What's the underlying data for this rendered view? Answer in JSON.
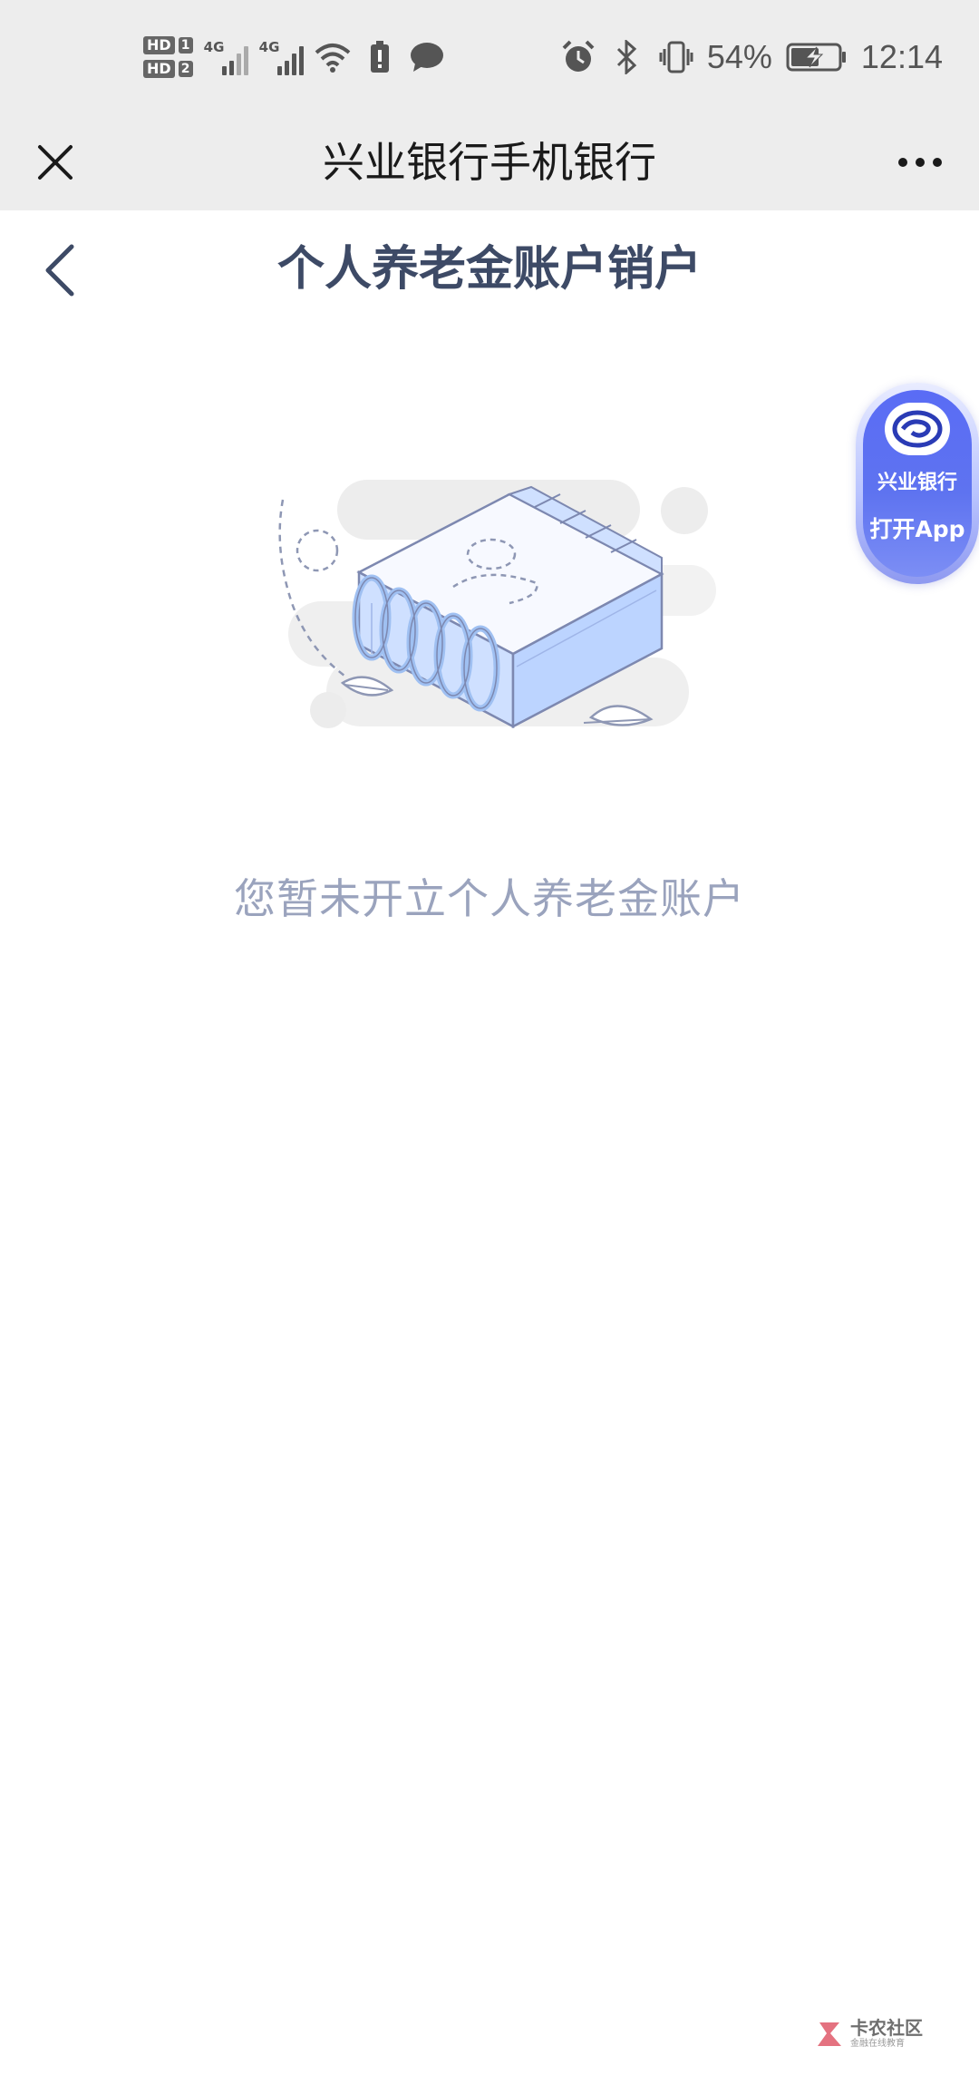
{
  "status_bar": {
    "hd1": "HD",
    "sim1": "1",
    "hd2": "HD",
    "sim2": "2",
    "net1": "4G",
    "net2": "4G",
    "battery_percent": "54%",
    "time": "12:14",
    "icons": [
      "signal-icon",
      "wifi-icon",
      "battery-alert-icon",
      "message-icon",
      "alarm-icon",
      "bluetooth-icon",
      "vibrate-icon",
      "battery-charging-icon"
    ]
  },
  "top_bar": {
    "title": "兴业银行手机银行",
    "close_icon": "close-icon",
    "more_icon": "more-icon"
  },
  "page_header": {
    "title": "个人养老金账户销户",
    "back_icon": "chevron-left-icon"
  },
  "empty_state": {
    "illustration": "empty-notebook-illustration",
    "message": "您暂未开立个人养老金账户"
  },
  "floating_app": {
    "bank_name": "兴业银行",
    "open_label": "打开App"
  },
  "watermark": {
    "main": "卡农社区",
    "sub": "金融在线教育"
  },
  "colors": {
    "topbar_bg": "#ededed",
    "title_color": "#3d4a66",
    "empty_text": "#9aa3bd",
    "float_blue": "#5a6cf5"
  }
}
